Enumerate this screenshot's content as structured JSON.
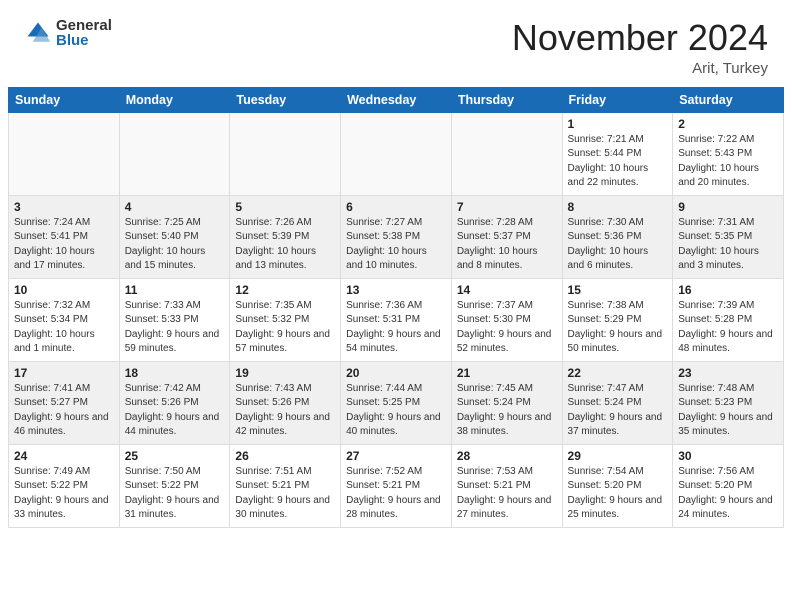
{
  "header": {
    "logo_general": "General",
    "logo_blue": "Blue",
    "month_title": "November 2024",
    "location": "Arit, Turkey"
  },
  "days_of_week": [
    "Sunday",
    "Monday",
    "Tuesday",
    "Wednesday",
    "Thursday",
    "Friday",
    "Saturday"
  ],
  "weeks": [
    [
      {
        "day": "",
        "info": ""
      },
      {
        "day": "",
        "info": ""
      },
      {
        "day": "",
        "info": ""
      },
      {
        "day": "",
        "info": ""
      },
      {
        "day": "",
        "info": ""
      },
      {
        "day": "1",
        "info": "Sunrise: 7:21 AM\nSunset: 5:44 PM\nDaylight: 10 hours and 22 minutes."
      },
      {
        "day": "2",
        "info": "Sunrise: 7:22 AM\nSunset: 5:43 PM\nDaylight: 10 hours and 20 minutes."
      }
    ],
    [
      {
        "day": "3",
        "info": "Sunrise: 7:24 AM\nSunset: 5:41 PM\nDaylight: 10 hours and 17 minutes."
      },
      {
        "day": "4",
        "info": "Sunrise: 7:25 AM\nSunset: 5:40 PM\nDaylight: 10 hours and 15 minutes."
      },
      {
        "day": "5",
        "info": "Sunrise: 7:26 AM\nSunset: 5:39 PM\nDaylight: 10 hours and 13 minutes."
      },
      {
        "day": "6",
        "info": "Sunrise: 7:27 AM\nSunset: 5:38 PM\nDaylight: 10 hours and 10 minutes."
      },
      {
        "day": "7",
        "info": "Sunrise: 7:28 AM\nSunset: 5:37 PM\nDaylight: 10 hours and 8 minutes."
      },
      {
        "day": "8",
        "info": "Sunrise: 7:30 AM\nSunset: 5:36 PM\nDaylight: 10 hours and 6 minutes."
      },
      {
        "day": "9",
        "info": "Sunrise: 7:31 AM\nSunset: 5:35 PM\nDaylight: 10 hours and 3 minutes."
      }
    ],
    [
      {
        "day": "10",
        "info": "Sunrise: 7:32 AM\nSunset: 5:34 PM\nDaylight: 10 hours and 1 minute."
      },
      {
        "day": "11",
        "info": "Sunrise: 7:33 AM\nSunset: 5:33 PM\nDaylight: 9 hours and 59 minutes."
      },
      {
        "day": "12",
        "info": "Sunrise: 7:35 AM\nSunset: 5:32 PM\nDaylight: 9 hours and 57 minutes."
      },
      {
        "day": "13",
        "info": "Sunrise: 7:36 AM\nSunset: 5:31 PM\nDaylight: 9 hours and 54 minutes."
      },
      {
        "day": "14",
        "info": "Sunrise: 7:37 AM\nSunset: 5:30 PM\nDaylight: 9 hours and 52 minutes."
      },
      {
        "day": "15",
        "info": "Sunrise: 7:38 AM\nSunset: 5:29 PM\nDaylight: 9 hours and 50 minutes."
      },
      {
        "day": "16",
        "info": "Sunrise: 7:39 AM\nSunset: 5:28 PM\nDaylight: 9 hours and 48 minutes."
      }
    ],
    [
      {
        "day": "17",
        "info": "Sunrise: 7:41 AM\nSunset: 5:27 PM\nDaylight: 9 hours and 46 minutes."
      },
      {
        "day": "18",
        "info": "Sunrise: 7:42 AM\nSunset: 5:26 PM\nDaylight: 9 hours and 44 minutes."
      },
      {
        "day": "19",
        "info": "Sunrise: 7:43 AM\nSunset: 5:26 PM\nDaylight: 9 hours and 42 minutes."
      },
      {
        "day": "20",
        "info": "Sunrise: 7:44 AM\nSunset: 5:25 PM\nDaylight: 9 hours and 40 minutes."
      },
      {
        "day": "21",
        "info": "Sunrise: 7:45 AM\nSunset: 5:24 PM\nDaylight: 9 hours and 38 minutes."
      },
      {
        "day": "22",
        "info": "Sunrise: 7:47 AM\nSunset: 5:24 PM\nDaylight: 9 hours and 37 minutes."
      },
      {
        "day": "23",
        "info": "Sunrise: 7:48 AM\nSunset: 5:23 PM\nDaylight: 9 hours and 35 minutes."
      }
    ],
    [
      {
        "day": "24",
        "info": "Sunrise: 7:49 AM\nSunset: 5:22 PM\nDaylight: 9 hours and 33 minutes."
      },
      {
        "day": "25",
        "info": "Sunrise: 7:50 AM\nSunset: 5:22 PM\nDaylight: 9 hours and 31 minutes."
      },
      {
        "day": "26",
        "info": "Sunrise: 7:51 AM\nSunset: 5:21 PM\nDaylight: 9 hours and 30 minutes."
      },
      {
        "day": "27",
        "info": "Sunrise: 7:52 AM\nSunset: 5:21 PM\nDaylight: 9 hours and 28 minutes."
      },
      {
        "day": "28",
        "info": "Sunrise: 7:53 AM\nSunset: 5:21 PM\nDaylight: 9 hours and 27 minutes."
      },
      {
        "day": "29",
        "info": "Sunrise: 7:54 AM\nSunset: 5:20 PM\nDaylight: 9 hours and 25 minutes."
      },
      {
        "day": "30",
        "info": "Sunrise: 7:56 AM\nSunset: 5:20 PM\nDaylight: 9 hours and 24 minutes."
      }
    ]
  ]
}
